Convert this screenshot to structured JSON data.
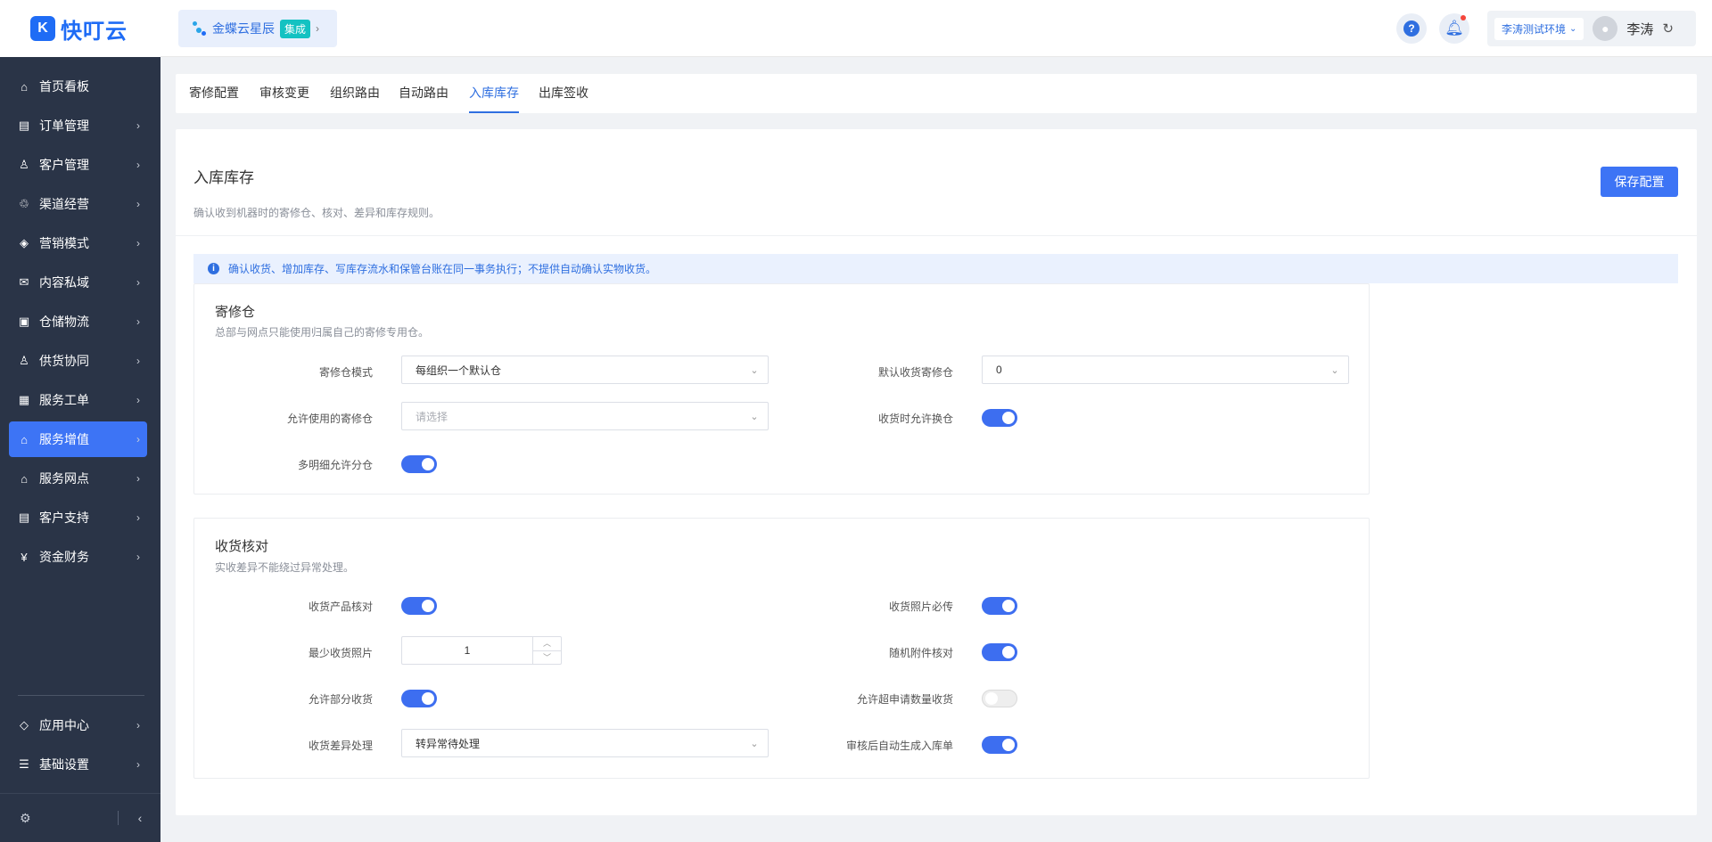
{
  "app": {
    "logo_mark": "K",
    "logo_text": "快叮云"
  },
  "header": {
    "brand_name": "金蝶云星辰",
    "brand_tag": "集成",
    "help_icon": "question-circle-icon",
    "notification_icon": "bell-icon",
    "environment": "李涛测试环境",
    "user_name": "李涛"
  },
  "sidebar": {
    "items": [
      {
        "label": "首页看板",
        "icon": "⌂",
        "has_arrow": false,
        "active": false
      },
      {
        "label": "订单管理",
        "icon": "▤",
        "has_arrow": true,
        "active": false
      },
      {
        "label": "客户管理",
        "icon": "♙",
        "has_arrow": true,
        "active": false
      },
      {
        "label": "渠道经营",
        "icon": "♲",
        "has_arrow": true,
        "active": false
      },
      {
        "label": "营销模式",
        "icon": "◈",
        "has_arrow": true,
        "active": false
      },
      {
        "label": "内容私域",
        "icon": "✉",
        "has_arrow": true,
        "active": false
      },
      {
        "label": "仓储物流",
        "icon": "▣",
        "has_arrow": true,
        "active": false
      },
      {
        "label": "供货协同",
        "icon": "♙",
        "has_arrow": true,
        "active": false
      },
      {
        "label": "服务工单",
        "icon": "▦",
        "has_arrow": true,
        "active": false
      },
      {
        "label": "服务增值",
        "icon": "⌂",
        "has_arrow": true,
        "active": true
      },
      {
        "label": "服务网点",
        "icon": "⌂",
        "has_arrow": true,
        "active": false
      },
      {
        "label": "客户支持",
        "icon": "▤",
        "has_arrow": true,
        "active": false
      },
      {
        "label": "资金财务",
        "icon": "¥",
        "has_arrow": true,
        "active": false
      }
    ],
    "bottom_items": [
      {
        "label": "应用中心",
        "icon": "◇"
      },
      {
        "label": "基础设置",
        "icon": "☰"
      }
    ]
  },
  "tabs": [
    "寄修配置",
    "审核变更",
    "组织路由",
    "自动路由",
    "入库库存",
    "出库签收"
  ],
  "active_tab": "入库库存",
  "page": {
    "title": "入库库存",
    "description": "确认收到机器时的寄修仓、核对、差异和库存规则。",
    "save_label": "保存配置",
    "alert": "确认收货、增加库存、写库存流水和保管台账在同一事务执行；不提供自动确认实物收货。"
  },
  "section_warehouse": {
    "title": "寄修仓",
    "description": "总部与网点只能使用归属自己的寄修专用仓。",
    "fields": {
      "mode_label": "寄修仓模式",
      "mode_value": "每组织一个默认仓",
      "default_label": "默认收货寄修仓",
      "default_value": "0",
      "allowed_label": "允许使用的寄修仓",
      "allowed_placeholder": "请选择",
      "switch_label": "收货时允许换仓",
      "switch_value": true,
      "split_label": "多明细允许分仓",
      "split_value": true
    }
  },
  "section_check": {
    "title": "收货核对",
    "description": "实收差异不能绕过异常处理。",
    "fields": {
      "product_check_label": "收货产品核对",
      "product_check_value": true,
      "photo_required_label": "收货照片必传",
      "photo_required_value": true,
      "min_photos_label": "最少收货照片",
      "min_photos_value": "1",
      "accessory_label": "随机附件核对",
      "accessory_value": true,
      "partial_label": "允许部分收货",
      "partial_value": true,
      "over_qty_label": "允许超申请数量收货",
      "over_qty_value": false,
      "diff_label": "收货差异处理",
      "diff_value": "转异常待处理",
      "auto_gen_label": "审核后自动生成入库单",
      "auto_gen_value": true
    }
  }
}
